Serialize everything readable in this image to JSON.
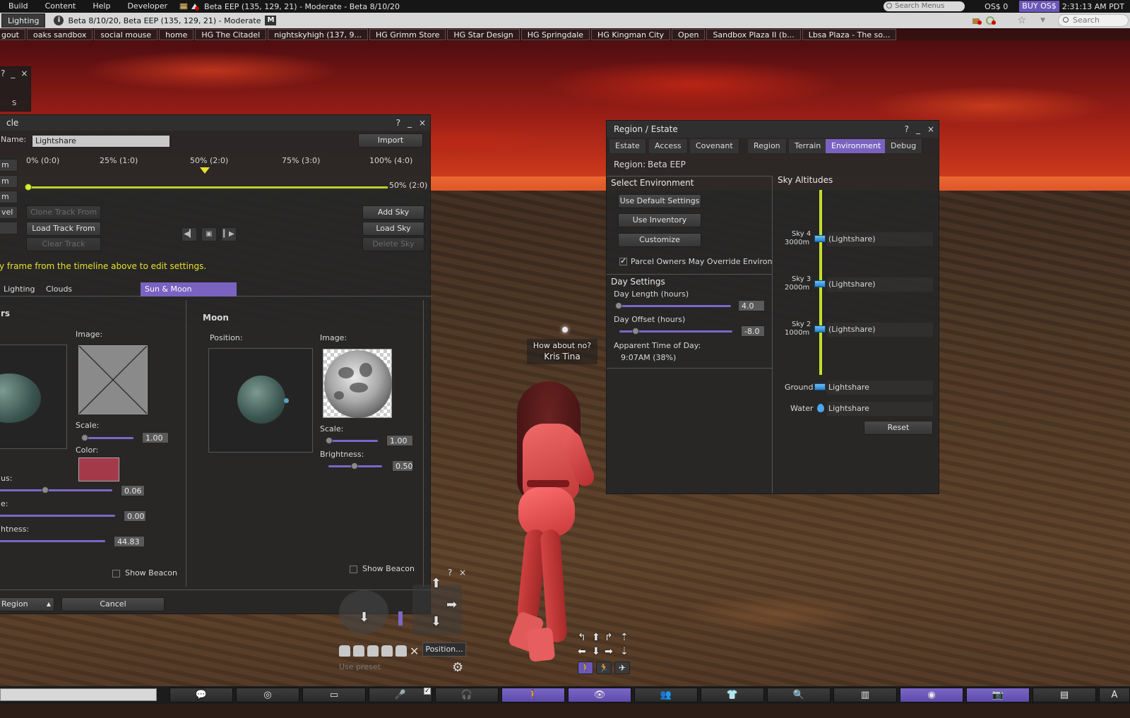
{
  "menubar": {
    "items": [
      "Build",
      "Content",
      "Help",
      "Developer"
    ],
    "window_title": "Beta EEP (135, 129, 21) - Moderate - Beta 8/10/20",
    "search_placeholder": "Search Menus",
    "balance": "OS$ 0",
    "buy_label": "BUY OS$",
    "clock": "2:31:13 AM PDT"
  },
  "navbar": {
    "left_button": "Lighting",
    "location": "Beta 8/10/20, Beta EEP (135, 129, 21) - Moderate",
    "maturity_badge": "M",
    "search_placeholder": "Search"
  },
  "favorites": [
    "gout",
    "oaks sandbox",
    "social mouse",
    "home",
    "HG The Citadel",
    "nightskyhigh (137, 9...",
    "HG Grimm Store",
    "HG Star Design",
    "HG Springdale",
    "HG Kingman City",
    "Open",
    "Sandbox Plaza II (b...",
    "Lbsa Plaza - The so..."
  ],
  "small_floater": {
    "ctrls": [
      "?",
      "_",
      "×"
    ],
    "label": "S"
  },
  "daycycle": {
    "title": "cle",
    "ctrls": [
      "?",
      "_",
      "×"
    ],
    "name_label": "Name:",
    "name_value": "Lightshare",
    "import_button": "Import",
    "side_tabs": [
      "m",
      "m",
      "m",
      "vel",
      ""
    ],
    "timeline_labels": [
      "0% (0:0)",
      "25% (1:0)",
      "50% (2:0)",
      "75% (3:0)",
      "100% (4:0)"
    ],
    "timeline_end_label": "50% (2:0)",
    "timeline_position": 0.5,
    "buttons": {
      "clone_track": "Clone Track From",
      "load_track": "Load Track From",
      "clear_track": "Clear Track",
      "add_sky": "Add Sky",
      "load_sky": "Load Sky",
      "delete_sky": "Delete Sky"
    },
    "media": [
      "prev-frame-icon",
      "camera-icon",
      "next-frame-icon"
    ],
    "hint": "y frame from the timeline above to edit settings.",
    "tabs": [
      "Lighting",
      "Clouds",
      "Sun & Moon"
    ],
    "active_tab": "Sun & Moon",
    "sun": {
      "heading": "rs",
      "image_label": "Image:",
      "scale_label": "Scale:",
      "scale_value": "1.00",
      "color_label": "Color:",
      "color": "#a33a4a",
      "glow_label": "us:",
      "glow_value": "0.06",
      "focus_label": "e:",
      "focus_value": "0.00",
      "brightness_label": "htness:",
      "brightness_value": "44.83",
      "beacon_label": "Show Beacon"
    },
    "moon": {
      "heading": "Moon",
      "position_label": "Position:",
      "image_label": "Image:",
      "scale_label": "Scale:",
      "scale_value": "1.00",
      "brightness_label": "Brightness:",
      "brightness_value": "0.50",
      "beacon_label": "Show Beacon"
    },
    "footer": {
      "apply_label": "Region",
      "cancel": "Cancel"
    }
  },
  "region": {
    "title": "Region / Estate",
    "ctrls": [
      "?",
      "_",
      "×"
    ],
    "tabs": [
      "Estate",
      "Access",
      "Covenant",
      "Region",
      "Terrain",
      "Environment",
      "Debug"
    ],
    "active_tab": "Environment",
    "region_label": "Region:",
    "region_name": "Beta EEP",
    "select_env": {
      "heading": "Select Environment",
      "default_btn": "Use Default Settings",
      "inventory_btn": "Use Inventory",
      "customize_btn": "Customize",
      "override_label": "Parcel Owners May Override Environm",
      "override_checked": true
    },
    "day": {
      "heading": "Day Settings",
      "length_label": "Day Length (hours)",
      "length_value": "4.0",
      "offset_label": "Day Offset (hours)",
      "offset_value": "-8.0",
      "apparent_label": "Apparent Time of Day:",
      "apparent_value": "9:07AM (38%)"
    },
    "altitudes": {
      "heading": "Sky Altitudes",
      "skies": [
        {
          "name": "Sky 4",
          "alt": "3000m",
          "setting": "(Lightshare)"
        },
        {
          "name": "Sky 3",
          "alt": "2000m",
          "setting": "(Lightshare)"
        },
        {
          "name": "Sky 2",
          "alt": "1000m",
          "setting": "(Lightshare)"
        }
      ],
      "ground_label": "Ground",
      "ground_value": "Lightshare",
      "water_label": "Water",
      "water_value": "Lightshare",
      "reset": "Reset"
    }
  },
  "scene": {
    "chat_bubble": "How about no?",
    "avatar_name": "Kris Tina"
  },
  "camera": {
    "ctrls": [
      "?",
      "×"
    ],
    "position_button": "Position...",
    "use_preset": "Use preset"
  },
  "toolbar": {
    "buttons": [
      "chat-icon",
      "snapshot-wheel-icon",
      "camera-icon",
      "voice-icon",
      "headphones-icon",
      "move-icon",
      "view-icon",
      "people-icon",
      "appearance-icon",
      "search-icon",
      "map-icon",
      "radar-icon",
      "photo-icon",
      "inventory-icon"
    ],
    "active": [
      "move-icon",
      "view-icon",
      "radar-icon",
      "photo-icon"
    ],
    "right_label": "A"
  },
  "colors": {
    "accent": "#7a62c0",
    "timeline": "#b4d62a",
    "hint": "#e8e02a"
  }
}
